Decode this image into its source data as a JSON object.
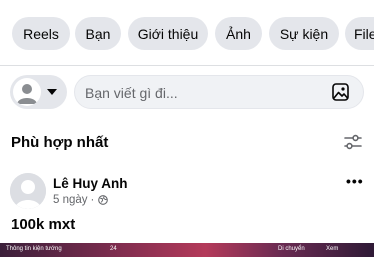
{
  "tabs": [
    "Reels",
    "Bạn",
    "Giới thiệu",
    "Ảnh",
    "Sự kiện",
    "File"
  ],
  "composer": {
    "placeholder": "Bạn viết gì đi..."
  },
  "feed": {
    "sort_label": "Phù hợp nhất"
  },
  "post": {
    "author": "Lê Huy Anh",
    "time": "5 ngày",
    "separator": "·",
    "text": "100k mxt",
    "media_hud": {
      "left_label": "Thông tin kiện tướng",
      "counter": "24",
      "right_label_1": "Di chuyển",
      "right_label_2": "Xem"
    }
  },
  "colors": {
    "tab_bg": "#e4e6eb",
    "input_bg": "#f0f2f5",
    "secondary_text": "#65676b"
  }
}
